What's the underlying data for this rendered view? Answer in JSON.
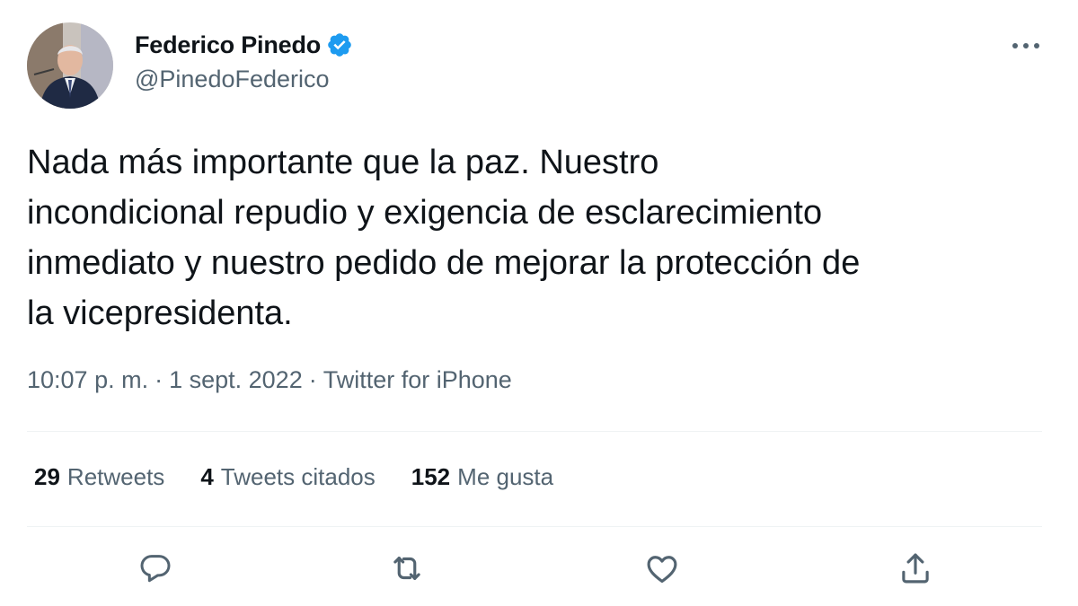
{
  "author": {
    "display_name": "Federico Pinedo",
    "handle": "@PinedoFederico",
    "verified_icon": "verified-badge-icon",
    "avatar_icon": "profile-photo"
  },
  "tweet": {
    "text": "Nada más importante que la paz. Nuestro\nincondicional repudio y exigencia de esclarecimiento\ninmediato y nuestro pedido de mejorar la protección de\nla vicepresidenta.",
    "time": "10:07 p. m.",
    "date": "1 sept. 2022",
    "source": "Twitter for iPhone",
    "separator": "·"
  },
  "stats": {
    "retweets": {
      "count": "29",
      "label": "Retweets"
    },
    "quotes": {
      "count": "4",
      "label": "Tweets citados"
    },
    "likes": {
      "count": "152",
      "label": "Me gusta"
    }
  },
  "actions": [
    {
      "name": "reply",
      "icon": "reply-icon"
    },
    {
      "name": "retweet",
      "icon": "retweet-icon"
    },
    {
      "name": "like",
      "icon": "heart-icon"
    },
    {
      "name": "share",
      "icon": "share-icon"
    }
  ],
  "colors": {
    "text": "#0f1419",
    "secondary": "#536471",
    "verified": "#1d9bf0",
    "divider": "#eff3f4"
  }
}
